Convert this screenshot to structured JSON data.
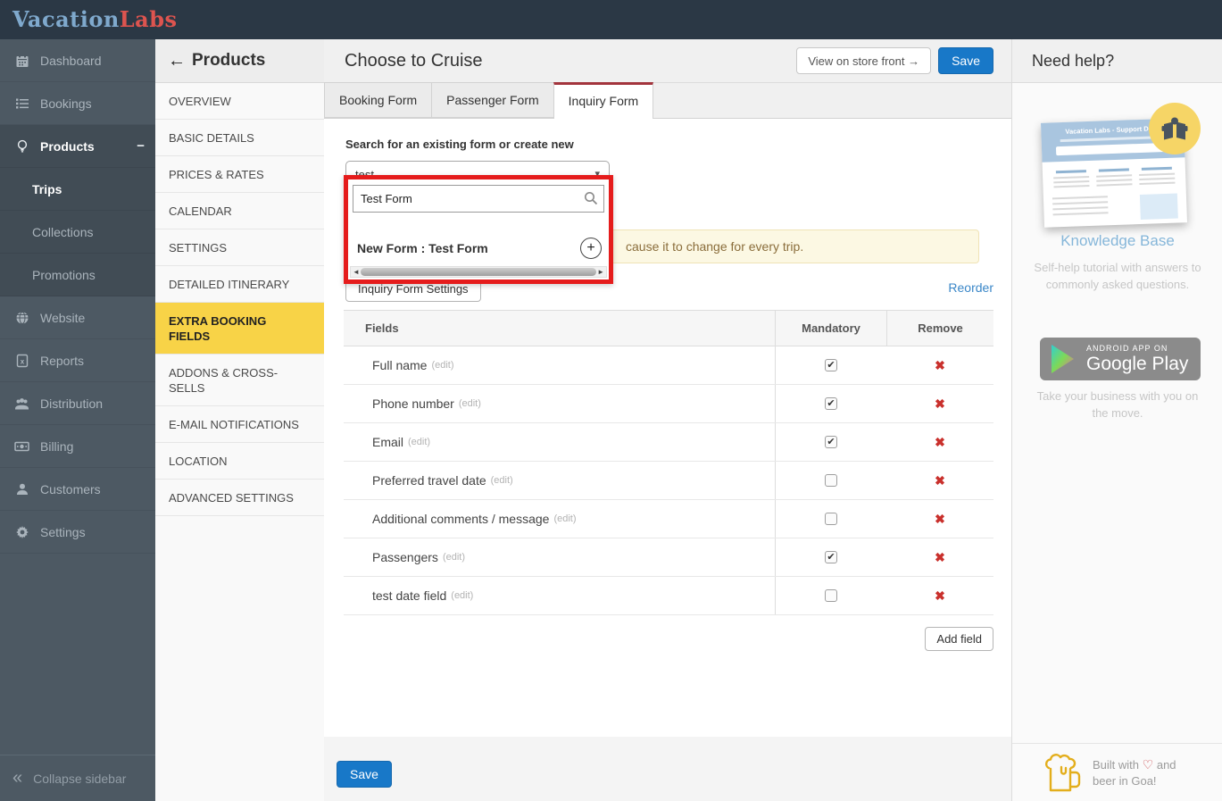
{
  "topbar": {
    "brand_primary": "Vacation",
    "brand_secondary": "Labs"
  },
  "sidebar": {
    "items": [
      {
        "label": "Dashboard",
        "icon": "calendar"
      },
      {
        "label": "Bookings",
        "icon": "list"
      },
      {
        "label": "Products",
        "icon": "bulb",
        "group": true,
        "head": true,
        "expanded": true
      },
      {
        "label": "Trips",
        "sub": true,
        "group": true,
        "active": true
      },
      {
        "label": "Collections",
        "sub": true,
        "group": true
      },
      {
        "label": "Promotions",
        "sub": true,
        "group": true
      },
      {
        "label": "Website",
        "icon": "globe"
      },
      {
        "label": "Reports",
        "icon": "report"
      },
      {
        "label": "Distribution",
        "icon": "users"
      },
      {
        "label": "Billing",
        "icon": "billing"
      },
      {
        "label": "Customers",
        "icon": "user"
      },
      {
        "label": "Settings",
        "icon": "gear"
      }
    ],
    "collapse_label": "Collapse sidebar"
  },
  "submenu": {
    "title": "Products",
    "items": [
      "OVERVIEW",
      "BASIC DETAILS",
      "PRICES & RATES",
      "CALENDAR",
      "SETTINGS",
      "DETAILED ITINERARY",
      "EXTRA BOOKING FIELDS",
      "ADDONS & CROSS-SELLS",
      "E-MAIL NOTIFICATIONS",
      "LOCATION",
      "ADVANCED SETTINGS"
    ],
    "active_item": "EXTRA BOOKING FIELDS"
  },
  "header": {
    "title": "Choose to Cruise",
    "view_store_label": "View on store front →",
    "save_label": "Save"
  },
  "tabs": [
    {
      "label": "Booking Form",
      "active": false
    },
    {
      "label": "Passenger Form",
      "active": false
    },
    {
      "label": "Inquiry Form",
      "active": true
    }
  ],
  "form_section": {
    "search_label": "Search for an existing form or create new",
    "select_value": "test",
    "dropdown": {
      "search_value": "Test Form",
      "result_label": "New Form : Test Form"
    },
    "alert_text": "cause it to change for every trip.",
    "settings_button": "Inquiry Form Settings",
    "reorder_link": "Reorder"
  },
  "fields_table": {
    "columns": [
      "Fields",
      "Mandatory",
      "Remove"
    ],
    "edit_suffix": "(edit)",
    "rows": [
      {
        "name": "Full name",
        "mandatory": true
      },
      {
        "name": "Phone number",
        "mandatory": true
      },
      {
        "name": "Email",
        "mandatory": true
      },
      {
        "name": "Preferred travel date",
        "mandatory": false
      },
      {
        "name": "Additional comments / message",
        "mandatory": false
      },
      {
        "name": "Passengers",
        "mandatory": true
      },
      {
        "name": "test date field",
        "mandatory": false
      }
    ],
    "add_field_label": "Add field"
  },
  "footer": {
    "save_label": "Save"
  },
  "help": {
    "title": "Need help?",
    "card_title": "Vacation Labs - Support Desk",
    "knowledge_base_label": "Knowledge Base",
    "knowledge_base_desc": "Self-help tutorial with answers to commonly asked questions.",
    "play_badge_top": "ANDROID APP ON",
    "play_badge_main": "Google Play",
    "play_desc": "Take your business with you on the move.",
    "built_line1": "Built with",
    "built_heart": "♡",
    "built_line2": "and",
    "built_line3": "beer in Goa!"
  },
  "glyphs": {
    "minus": "−",
    "collapse": "«",
    "back_arrow": "←",
    "caret": "▾",
    "plus": "+",
    "check": "✔",
    "remove": "✖",
    "scroll_left": "◄",
    "scroll_right": "►"
  },
  "colors": {
    "topbar": "#2b3845",
    "brand_blue": "#7fa9cd",
    "brand_red": "#dd544f",
    "sidebar": "#4d5963",
    "sidebar_active_group": "#414c55",
    "submenu_highlight": "#f8d347",
    "primary_button": "#1878c8",
    "active_tab_accent": "#a2343c",
    "annotation_red": "#e51c1c",
    "remove_red": "#c9302c",
    "alert_bg": "#fcf8e3",
    "alert_text": "#8a6d3b",
    "knowledge_base_blue": "#85b6d9",
    "beer_yellow": "#e3ae1c"
  }
}
